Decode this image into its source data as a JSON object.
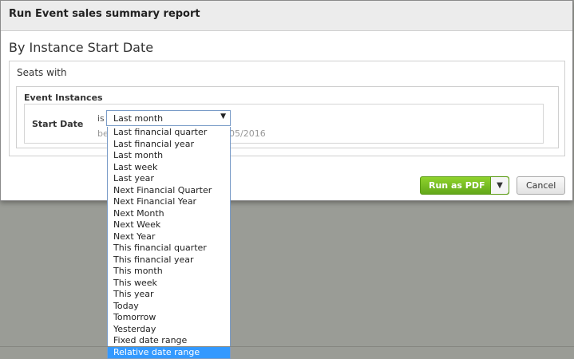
{
  "dialog": {
    "title": "Run Event sales summary report",
    "heading": "By Instance Start Date"
  },
  "filters": {
    "seats_label": "Seats with",
    "instances_label": "Event Instances",
    "start_label": "Start Date",
    "is_label": "is",
    "between_label": "be",
    "date_end": "05/2016"
  },
  "select": {
    "value": "Last month",
    "options": [
      "Last financial quarter",
      "Last financial year",
      "Last month",
      "Last week",
      "Last year",
      "Next Financial Quarter",
      "Next Financial Year",
      "Next Month",
      "Next Week",
      "Next Year",
      "This financial quarter",
      "This financial year",
      "This month",
      "This week",
      "This year",
      "Today",
      "Tomorrow",
      "Yesterday",
      "Fixed date range",
      "Relative date range"
    ],
    "highlighted": "Relative date range"
  },
  "buttons": {
    "run_label": "Run as PDF",
    "cancel_label": "Cancel"
  },
  "colors": {
    "accent": "#63a81a",
    "highlight": "#3399ff",
    "backdrop": "#9a9c96"
  }
}
